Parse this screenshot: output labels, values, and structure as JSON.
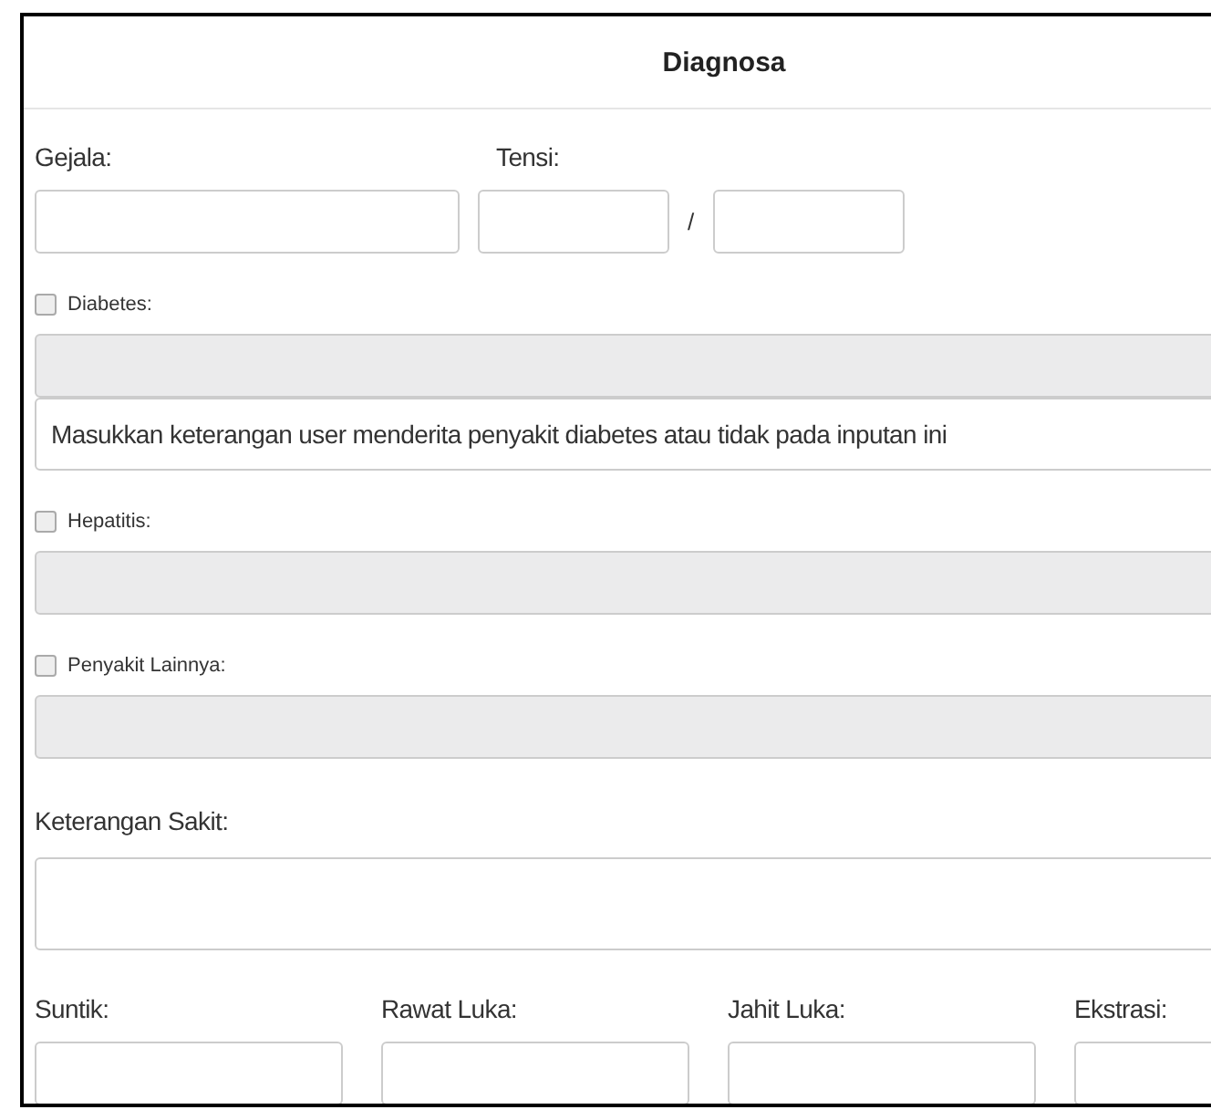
{
  "card": {
    "title": "Diagnosa"
  },
  "gejala": {
    "label": "Gejala:"
  },
  "tensi": {
    "label": "Tensi:",
    "separator": "/"
  },
  "conditions": [
    {
      "label": "Diabetes:",
      "checked": false,
      "hint": "Masukkan keterangan user menderita penyakit diabetes atau tidak pada inputan ini"
    },
    {
      "label": "Hepatitis:",
      "checked": false
    },
    {
      "label": "Penyakit Lainnya:",
      "checked": false
    }
  ],
  "keterangan": {
    "label": "Keterangan Sakit:"
  },
  "procedures": [
    {
      "label": "Suntik:"
    },
    {
      "label": "Rawat Luka:"
    },
    {
      "label": "Jahit Luka:"
    },
    {
      "label": "Ekstrasi:"
    }
  ]
}
